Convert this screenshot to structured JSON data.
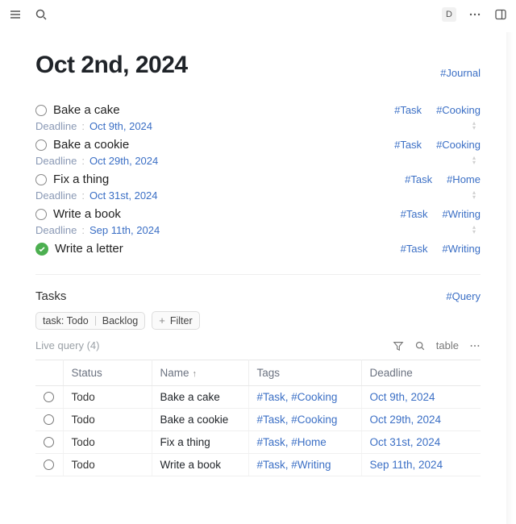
{
  "topbar": {
    "avatar_letter": "D"
  },
  "page": {
    "title": "Oct 2nd, 2024",
    "title_tag": "#Journal"
  },
  "tasks": [
    {
      "done": false,
      "title": "Bake a cake",
      "tags": [
        "#Task",
        "#Cooking"
      ],
      "deadline_label": "Deadline",
      "deadline": "Oct 9th, 2024",
      "has_deadline": true
    },
    {
      "done": false,
      "title": "Bake a cookie",
      "tags": [
        "#Task",
        "#Cooking"
      ],
      "deadline_label": "Deadline",
      "deadline": "Oct 29th, 2024",
      "has_deadline": true
    },
    {
      "done": false,
      "title": "Fix a thing",
      "tags": [
        "#Task",
        "#Home"
      ],
      "deadline_label": "Deadline",
      "deadline": "Oct 31st, 2024",
      "has_deadline": true
    },
    {
      "done": false,
      "title": "Write a book",
      "tags": [
        "#Task",
        "#Writing"
      ],
      "deadline_label": "Deadline",
      "deadline": "Sep 11th, 2024",
      "has_deadline": true
    },
    {
      "done": true,
      "title": "Write a letter",
      "tags": [
        "#Task",
        "#Writing"
      ],
      "has_deadline": false
    }
  ],
  "section": {
    "title": "Tasks",
    "title_tag": "#Query",
    "filter_chip_a": "task: Todo",
    "filter_chip_b": "Backlog",
    "add_filter_label": "Filter",
    "live_label": "Live query (4)",
    "view_label": "table"
  },
  "table": {
    "headers": {
      "status": "Status",
      "name": "Name",
      "tags": "Tags",
      "deadline": "Deadline"
    },
    "rows": [
      {
        "status": "Todo",
        "name": "Bake a cake",
        "tags": [
          "#Task",
          "#Cooking"
        ],
        "deadline": "Oct 9th, 2024"
      },
      {
        "status": "Todo",
        "name": "Bake a cookie",
        "tags": [
          "#Task",
          "#Cooking"
        ],
        "deadline": "Oct 29th, 2024"
      },
      {
        "status": "Todo",
        "name": "Fix a thing",
        "tags": [
          "#Task",
          "#Home"
        ],
        "deadline": "Oct 31st, 2024"
      },
      {
        "status": "Todo",
        "name": "Write a book",
        "tags": [
          "#Task",
          "#Writing"
        ],
        "deadline": "Sep 11th, 2024"
      }
    ]
  }
}
